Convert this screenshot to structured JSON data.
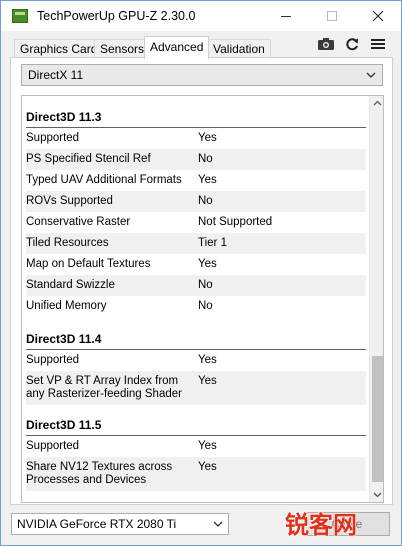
{
  "window": {
    "title": "TechPowerUp GPU-Z 2.30.0",
    "app_icon": "gpuz-app-icon",
    "controls": {
      "minimize_icon": "minimize-icon",
      "maximize_icon": "maximize-icon",
      "close_icon": "close-icon"
    }
  },
  "tabs": [
    {
      "label": "Graphics Card",
      "active": false
    },
    {
      "label": "Sensors",
      "active": false
    },
    {
      "label": "Advanced",
      "active": true
    },
    {
      "label": "Validation",
      "active": false
    }
  ],
  "toolbar": {
    "icons": [
      "camera-icon",
      "refresh-icon",
      "menu-icon"
    ]
  },
  "category_select": {
    "value": "DirectX 11"
  },
  "sections": [
    {
      "title": "Direct3D 11.3",
      "rows": [
        {
          "key": "Supported",
          "value": "Yes"
        },
        {
          "key": "PS Specified Stencil Ref",
          "value": "No"
        },
        {
          "key": "Typed UAV Additional Formats",
          "value": "Yes"
        },
        {
          "key": "ROVs Supported",
          "value": "No"
        },
        {
          "key": "Conservative Raster",
          "value": "Not Supported"
        },
        {
          "key": "Tiled Resources",
          "value": "Tier 1"
        },
        {
          "key": "Map on Default Textures",
          "value": "Yes"
        },
        {
          "key": "Standard Swizzle",
          "value": "No"
        },
        {
          "key": "Unified Memory",
          "value": "No"
        }
      ]
    },
    {
      "title": "Direct3D 11.4",
      "rows": [
        {
          "key": "Supported",
          "value": "Yes"
        },
        {
          "key": "Set VP & RT Array Index from any Rasterizer-feeding Shader",
          "value": "Yes"
        }
      ]
    },
    {
      "title": "Direct3D 11.5",
      "rows": [
        {
          "key": "Supported",
          "value": "Yes"
        },
        {
          "key": "Share NV12 Textures across Processes and Devices",
          "value": "Yes"
        }
      ]
    }
  ],
  "gpu_select": {
    "value": "NVIDIA GeForce RTX 2080 Ti"
  },
  "close_button": {
    "label": "Close"
  },
  "watermark": {
    "text": "锐客网"
  },
  "colors": {
    "accent_border": "#6f9fd6",
    "app_icon_green": "#4a8c2a",
    "watermark_red": "#e0301e"
  }
}
